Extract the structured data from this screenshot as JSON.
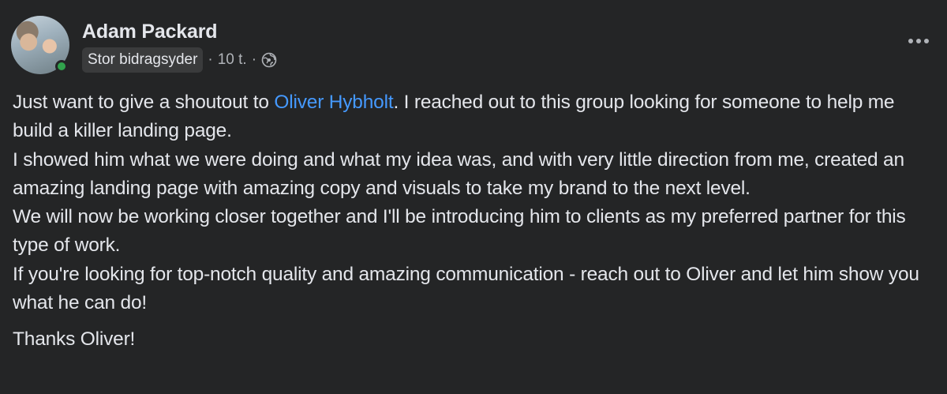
{
  "post": {
    "author": "Adam Packard",
    "badge": "Stor bidragsyder",
    "time": "10 t.",
    "separator": "·",
    "audience_icon": "globe-icon",
    "online": true,
    "body": {
      "p1_before": "Just want to give a shoutout to ",
      "mention": "Oliver Hybholt",
      "p1_after": ".  I reached out to this group looking for someone to help me build a killer landing page.",
      "p2": "I showed him what we were doing and what my idea was, and with very little direction from me, created an amazing landing page with amazing copy and visuals to take my brand to the next level.",
      "p3": "We will now be working closer together and I'll be introducing him to clients as my preferred partner for this type of work.",
      "p4": "If you're looking for top-notch quality and amazing communication - reach out to Oliver and let him show you what he can do!",
      "p5": "Thanks Oliver!"
    }
  },
  "colors": {
    "background": "#242526",
    "text": "#e4e6eb",
    "secondary": "#b0b3b8",
    "mention": "#4599ff",
    "online": "#31a24c"
  }
}
